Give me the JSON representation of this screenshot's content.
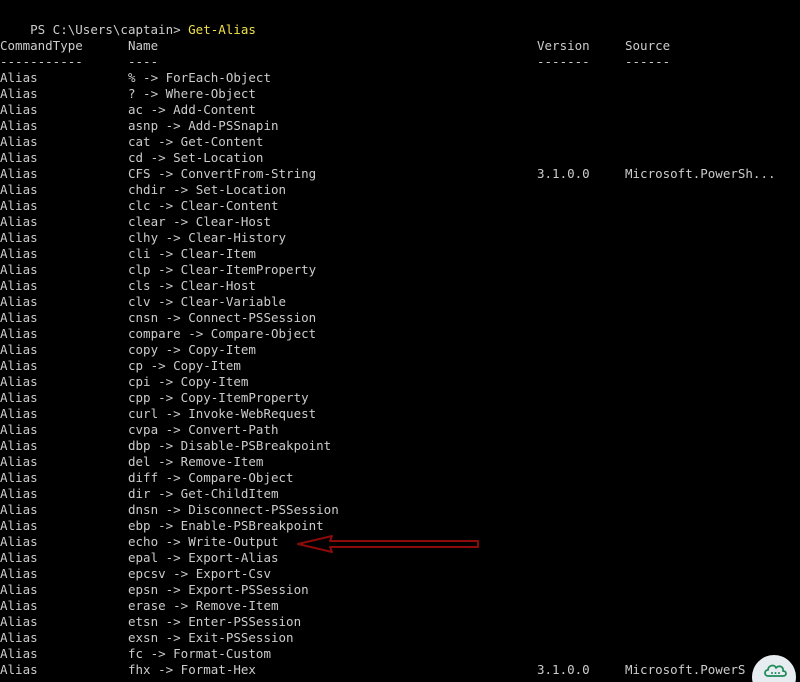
{
  "prompt": {
    "path": "PS C:\\Users\\captain> ",
    "command": "Get-Alias"
  },
  "columns": {
    "type": "CommandType",
    "name": "Name",
    "version": "Version",
    "source": "Source"
  },
  "separators": {
    "type": "-----------",
    "name": "----",
    "version": "-------",
    "source": "------"
  },
  "rows": [
    {
      "type": "Alias",
      "name": "% -> ForEach-Object",
      "version": "",
      "source": ""
    },
    {
      "type": "Alias",
      "name": "? -> Where-Object",
      "version": "",
      "source": ""
    },
    {
      "type": "Alias",
      "name": "ac -> Add-Content",
      "version": "",
      "source": ""
    },
    {
      "type": "Alias",
      "name": "asnp -> Add-PSSnapin",
      "version": "",
      "source": ""
    },
    {
      "type": "Alias",
      "name": "cat -> Get-Content",
      "version": "",
      "source": ""
    },
    {
      "type": "Alias",
      "name": "cd -> Set-Location",
      "version": "",
      "source": ""
    },
    {
      "type": "Alias",
      "name": "CFS -> ConvertFrom-String",
      "version": "3.1.0.0",
      "source": "Microsoft.PowerSh..."
    },
    {
      "type": "Alias",
      "name": "chdir -> Set-Location",
      "version": "",
      "source": ""
    },
    {
      "type": "Alias",
      "name": "clc -> Clear-Content",
      "version": "",
      "source": ""
    },
    {
      "type": "Alias",
      "name": "clear -> Clear-Host",
      "version": "",
      "source": ""
    },
    {
      "type": "Alias",
      "name": "clhy -> Clear-History",
      "version": "",
      "source": ""
    },
    {
      "type": "Alias",
      "name": "cli -> Clear-Item",
      "version": "",
      "source": ""
    },
    {
      "type": "Alias",
      "name": "clp -> Clear-ItemProperty",
      "version": "",
      "source": ""
    },
    {
      "type": "Alias",
      "name": "cls -> Clear-Host",
      "version": "",
      "source": ""
    },
    {
      "type": "Alias",
      "name": "clv -> Clear-Variable",
      "version": "",
      "source": ""
    },
    {
      "type": "Alias",
      "name": "cnsn -> Connect-PSSession",
      "version": "",
      "source": ""
    },
    {
      "type": "Alias",
      "name": "compare -> Compare-Object",
      "version": "",
      "source": ""
    },
    {
      "type": "Alias",
      "name": "copy -> Copy-Item",
      "version": "",
      "source": ""
    },
    {
      "type": "Alias",
      "name": "cp -> Copy-Item",
      "version": "",
      "source": ""
    },
    {
      "type": "Alias",
      "name": "cpi -> Copy-Item",
      "version": "",
      "source": ""
    },
    {
      "type": "Alias",
      "name": "cpp -> Copy-ItemProperty",
      "version": "",
      "source": ""
    },
    {
      "type": "Alias",
      "name": "curl -> Invoke-WebRequest",
      "version": "",
      "source": ""
    },
    {
      "type": "Alias",
      "name": "cvpa -> Convert-Path",
      "version": "",
      "source": ""
    },
    {
      "type": "Alias",
      "name": "dbp -> Disable-PSBreakpoint",
      "version": "",
      "source": ""
    },
    {
      "type": "Alias",
      "name": "del -> Remove-Item",
      "version": "",
      "source": ""
    },
    {
      "type": "Alias",
      "name": "diff -> Compare-Object",
      "version": "",
      "source": ""
    },
    {
      "type": "Alias",
      "name": "dir -> Get-ChildItem",
      "version": "",
      "source": ""
    },
    {
      "type": "Alias",
      "name": "dnsn -> Disconnect-PSSession",
      "version": "",
      "source": ""
    },
    {
      "type": "Alias",
      "name": "ebp -> Enable-PSBreakpoint",
      "version": "",
      "source": ""
    },
    {
      "type": "Alias",
      "name": "echo -> Write-Output",
      "version": "",
      "source": ""
    },
    {
      "type": "Alias",
      "name": "epal -> Export-Alias",
      "version": "",
      "source": ""
    },
    {
      "type": "Alias",
      "name": "epcsv -> Export-Csv",
      "version": "",
      "source": ""
    },
    {
      "type": "Alias",
      "name": "epsn -> Export-PSSession",
      "version": "",
      "source": ""
    },
    {
      "type": "Alias",
      "name": "erase -> Remove-Item",
      "version": "",
      "source": ""
    },
    {
      "type": "Alias",
      "name": "etsn -> Enter-PSSession",
      "version": "",
      "source": ""
    },
    {
      "type": "Alias",
      "name": "exsn -> Exit-PSSession",
      "version": "",
      "source": ""
    },
    {
      "type": "Alias",
      "name": "fc -> Format-Custom",
      "version": "",
      "source": ""
    },
    {
      "type": "Alias",
      "name": "fhx -> Format-Hex",
      "version": "3.1.0.0",
      "source": "Microsoft.PowerS"
    }
  ],
  "annotation": {
    "icon": "left-arrow-icon",
    "color": "#8b0a0a"
  },
  "badge": {
    "icon": "cloud-chat-icon",
    "color": "#1e8a5a"
  }
}
